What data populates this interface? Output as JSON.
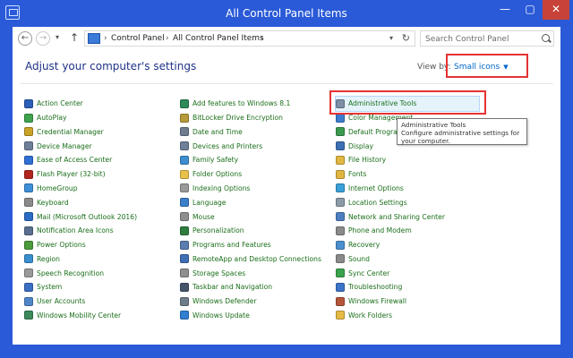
{
  "window": {
    "title": "All Control Panel Items",
    "min_label": "—",
    "max_label": "▢",
    "close_label": "✕"
  },
  "nav": {
    "back_glyph": "←",
    "forward_glyph": "→",
    "dropdown_glyph": "▾",
    "up_glyph": "↑",
    "separator": "›",
    "breadcrumbs": [
      "Control Panel",
      "All Control Panel Items"
    ],
    "address_dropdown_glyph": "▾",
    "refresh_glyph": "↻",
    "search_placeholder": "Search Control Panel"
  },
  "content": {
    "heading": "Adjust your computer's settings",
    "view_by_label": "View by:",
    "view_by_value": "Small icons",
    "view_by_caret": "▼"
  },
  "columns": [
    [
      {
        "label": "Action Center",
        "icon": "flag-icon",
        "color": "#2b5fb8"
      },
      {
        "label": "AutoPlay",
        "icon": "autoplay-icon",
        "color": "#3fa34d"
      },
      {
        "label": "Credential Manager",
        "icon": "credential-icon",
        "color": "#c9a227"
      },
      {
        "label": "Device Manager",
        "icon": "device-manager-icon",
        "color": "#6d7f99"
      },
      {
        "label": "Ease of Access Center",
        "icon": "ease-of-access-icon",
        "color": "#2f6fd6"
      },
      {
        "label": "Flash Player (32-bit)",
        "icon": "flash-icon",
        "color": "#b3261e"
      },
      {
        "label": "HomeGroup",
        "icon": "homegroup-icon",
        "color": "#3d8fd9"
      },
      {
        "label": "Keyboard",
        "icon": "keyboard-icon",
        "color": "#8a8a8a"
      },
      {
        "label": "Mail (Microsoft Outlook 2016)",
        "icon": "mail-icon",
        "color": "#2a6cc4"
      },
      {
        "label": "Notification Area Icons",
        "icon": "notification-icon",
        "color": "#5a6f8f"
      },
      {
        "label": "Power Options",
        "icon": "power-icon",
        "color": "#4b9b3a"
      },
      {
        "label": "Region",
        "icon": "region-icon",
        "color": "#3a8fce"
      },
      {
        "label": "Speech Recognition",
        "icon": "microphone-icon",
        "color": "#9a9a9a"
      },
      {
        "label": "System",
        "icon": "system-icon",
        "color": "#3b6fc4"
      },
      {
        "label": "User Accounts",
        "icon": "user-accounts-icon",
        "color": "#4f86c9"
      },
      {
        "label": "Windows Mobility Center",
        "icon": "mobility-icon",
        "color": "#3c8a5a"
      }
    ],
    [
      {
        "label": "Add features to Windows 8.1",
        "icon": "add-features-icon",
        "color": "#2e8b57"
      },
      {
        "label": "BitLocker Drive Encryption",
        "icon": "bitlocker-icon",
        "color": "#b69a3a"
      },
      {
        "label": "Date and Time",
        "icon": "clock-icon",
        "color": "#6e7d8f"
      },
      {
        "label": "Devices and Printers",
        "icon": "printer-icon",
        "color": "#6d7f99"
      },
      {
        "label": "Family Safety",
        "icon": "family-safety-icon",
        "color": "#3d8ecf"
      },
      {
        "label": "Folder Options",
        "icon": "folder-icon",
        "color": "#e8c14a"
      },
      {
        "label": "Indexing Options",
        "icon": "indexing-icon",
        "color": "#9a9a9a"
      },
      {
        "label": "Language",
        "icon": "language-icon",
        "color": "#3a7fc9"
      },
      {
        "label": "Mouse",
        "icon": "mouse-icon",
        "color": "#8e8e8e"
      },
      {
        "label": "Personalization",
        "icon": "personalization-icon",
        "color": "#2f7d3e"
      },
      {
        "label": "Programs and Features",
        "icon": "programs-icon",
        "color": "#5b7db0"
      },
      {
        "label": "RemoteApp and Desktop Connections",
        "icon": "remoteapp-icon",
        "color": "#3f6fb5"
      },
      {
        "label": "Storage Spaces",
        "icon": "storage-icon",
        "color": "#8f8f8f"
      },
      {
        "label": "Taskbar and Navigation",
        "icon": "taskbar-icon",
        "color": "#44546a"
      },
      {
        "label": "Windows Defender",
        "icon": "defender-icon",
        "color": "#6f7c8a"
      },
      {
        "label": "Windows Update",
        "icon": "windows-update-icon",
        "color": "#2f7fd1"
      }
    ],
    [
      {
        "label": "Administrative Tools",
        "icon": "administrative-tools-icon",
        "color": "#7c8fa6",
        "highlighted": true
      },
      {
        "label": "Color Management",
        "icon": "color-management-icon",
        "color": "#3d7ccf"
      },
      {
        "label": "Default Programs",
        "icon": "default-programs-icon",
        "color": "#3a9a4f"
      },
      {
        "label": "Display",
        "icon": "display-icon",
        "color": "#3d6fb5"
      },
      {
        "label": "File History",
        "icon": "file-history-icon",
        "color": "#e3b842"
      },
      {
        "label": "Fonts",
        "icon": "fonts-icon",
        "color": "#e0b640"
      },
      {
        "label": "Internet Options",
        "icon": "internet-options-icon",
        "color": "#3aa0d8"
      },
      {
        "label": "Location Settings",
        "icon": "location-icon",
        "color": "#8d9aa8"
      },
      {
        "label": "Network and Sharing Center",
        "icon": "network-icon",
        "color": "#4d7fc0"
      },
      {
        "label": "Phone and Modem",
        "icon": "phone-icon",
        "color": "#8a8a8a"
      },
      {
        "label": "Recovery",
        "icon": "recovery-icon",
        "color": "#4a8fce"
      },
      {
        "label": "Sound",
        "icon": "speaker-icon",
        "color": "#8a8a8a"
      },
      {
        "label": "Sync Center",
        "icon": "sync-icon",
        "color": "#3aa34d"
      },
      {
        "label": "Troubleshooting",
        "icon": "troubleshooting-icon",
        "color": "#3b74c9"
      },
      {
        "label": "Windows Firewall",
        "icon": "firewall-icon",
        "color": "#b5563a"
      },
      {
        "label": "Work Folders",
        "icon": "work-folders-icon",
        "color": "#e6bb44"
      }
    ]
  ],
  "tooltip": {
    "title": "Administrative Tools",
    "body": "Configure administrative settings for your computer."
  },
  "colors": {
    "title_bar": "#2a5ad7",
    "link_text": "#1a6e1a",
    "heading_text": "#1e3287",
    "annotation_red": "#e53333"
  }
}
